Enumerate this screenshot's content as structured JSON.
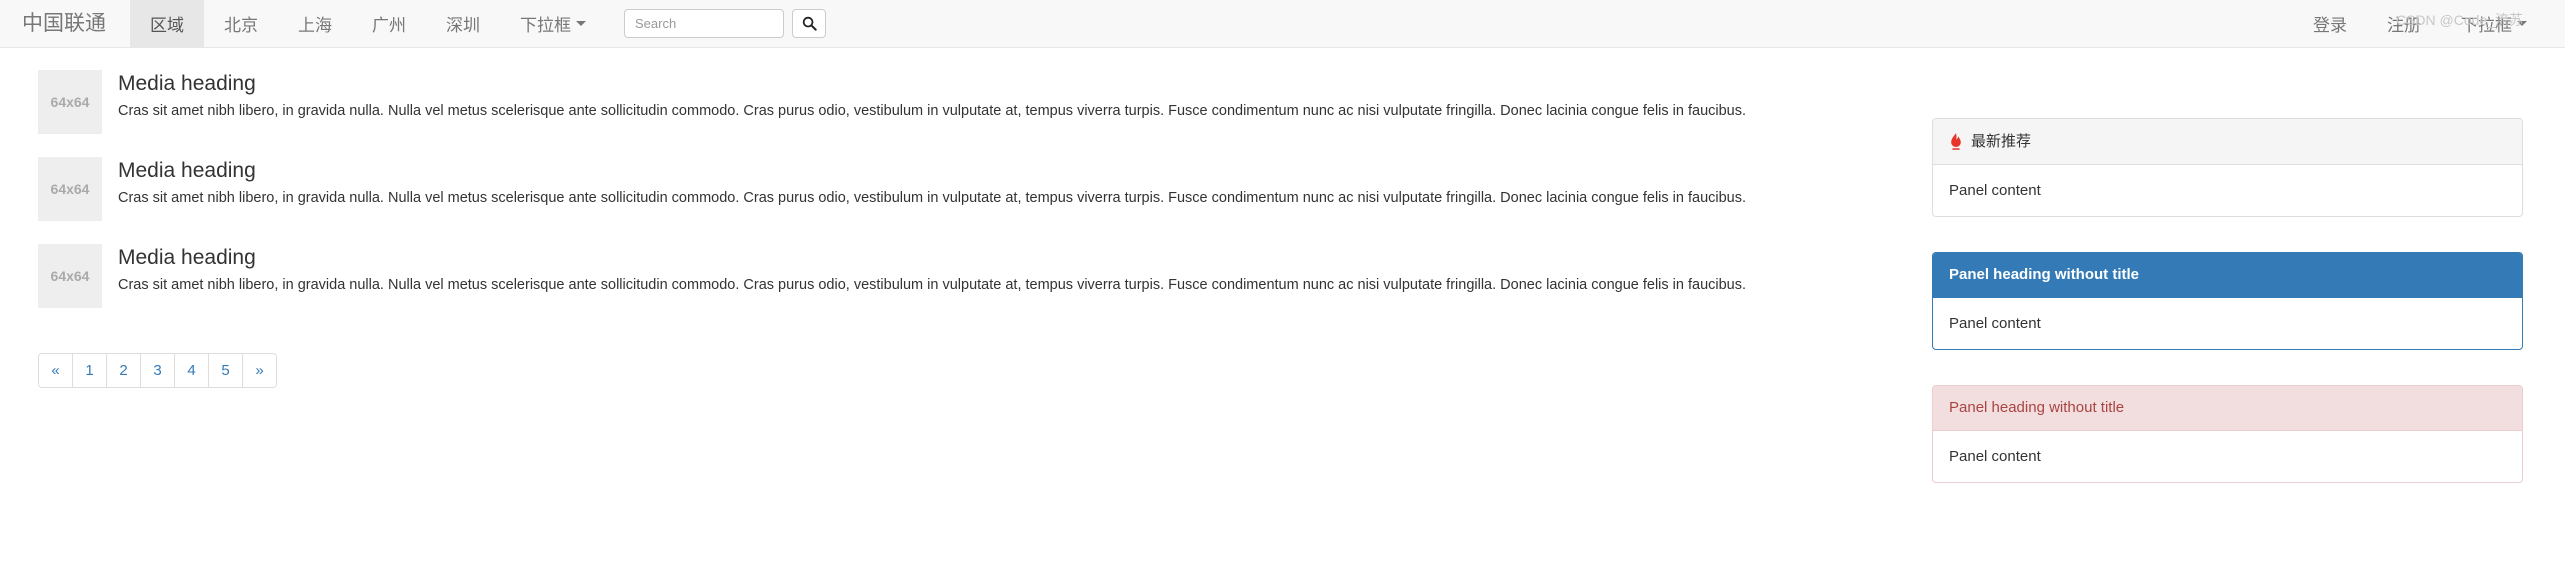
{
  "navbar": {
    "brand": "中国联通",
    "items": [
      {
        "label": "区域",
        "active": true,
        "caret": false
      },
      {
        "label": "北京",
        "active": false,
        "caret": false
      },
      {
        "label": "上海",
        "active": false,
        "caret": false
      },
      {
        "label": "广州",
        "active": false,
        "caret": false
      },
      {
        "label": "深圳",
        "active": false,
        "caret": false
      },
      {
        "label": "下拉框",
        "active": false,
        "caret": true
      }
    ],
    "search": {
      "placeholder": "Search",
      "value": "",
      "button_icon": "search-icon"
    },
    "right_items": [
      {
        "label": "登录",
        "caret": false
      },
      {
        "label": "注册",
        "caret": false
      },
      {
        "label": "下拉框",
        "caret": true
      }
    ]
  },
  "media_list": [
    {
      "thumb": "64x64",
      "heading": "Media heading",
      "text": "Cras sit amet nibh libero, in gravida nulla. Nulla vel metus scelerisque ante sollicitudin commodo. Cras purus odio, vestibulum in vulputate at, tempus viverra turpis. Fusce condimentum nunc ac nisi vulputate fringilla. Donec lacinia congue felis in faucibus."
    },
    {
      "thumb": "64x64",
      "heading": "Media heading",
      "text": "Cras sit amet nibh libero, in gravida nulla. Nulla vel metus scelerisque ante sollicitudin commodo. Cras purus odio, vestibulum in vulputate at, tempus viverra turpis. Fusce condimentum nunc ac nisi vulputate fringilla. Donec lacinia congue felis in faucibus."
    },
    {
      "thumb": "64x64",
      "heading": "Media heading",
      "text": "Cras sit amet nibh libero, in gravida nulla. Nulla vel metus scelerisque ante sollicitudin commodo. Cras purus odio, vestibulum in vulputate at, tempus viverra turpis. Fusce condimentum nunc ac nisi vulputate fringilla. Donec lacinia congue felis in faucibus."
    }
  ],
  "pagination": {
    "prev": "«",
    "pages": [
      "1",
      "2",
      "3",
      "4",
      "5"
    ],
    "next": "»"
  },
  "panels": [
    {
      "style": "default",
      "icon": "flame-icon",
      "heading": "最新推荐",
      "body": "Panel content"
    },
    {
      "style": "primary",
      "icon": null,
      "heading": "Panel heading without title",
      "body": "Panel content"
    },
    {
      "style": "danger",
      "icon": null,
      "heading": "Panel heading without title",
      "body": "Panel content"
    }
  ],
  "watermark": "CSDN @Code_流苏",
  "colors": {
    "navbar_bg": "#f8f8f8",
    "navbar_border": "#e7e7e7",
    "nav_active_bg": "#e7e7e7",
    "link": "#337ab7",
    "panel_primary": "#337ab7",
    "panel_danger_bg": "#f2dede",
    "panel_danger_border": "#ebccd1",
    "panel_danger_text": "#a94442",
    "thumb_bg": "#eeeeee",
    "flame_red": "#e8352a"
  }
}
